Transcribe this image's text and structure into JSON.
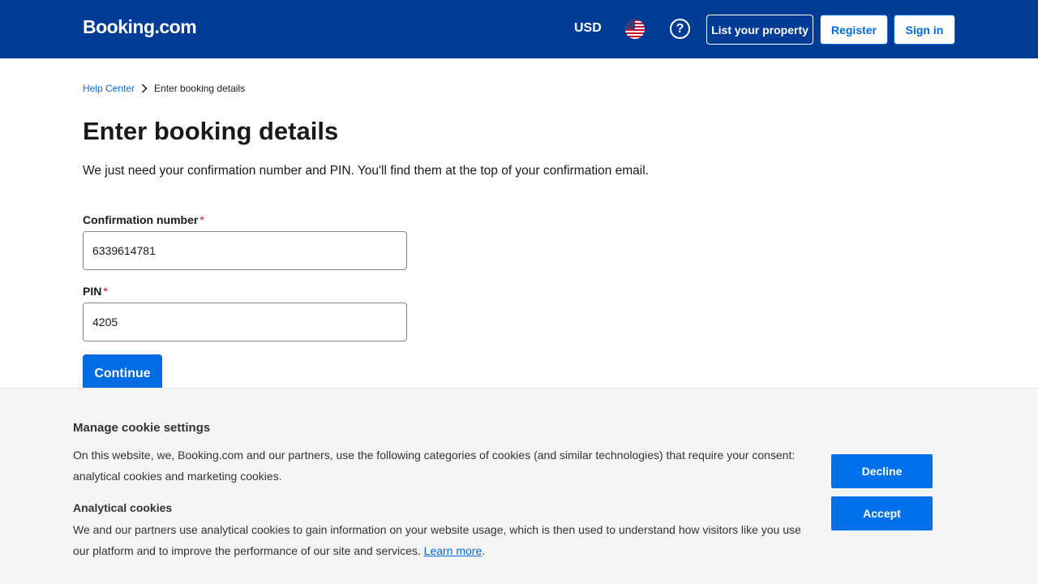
{
  "header": {
    "logo": "Booking.com",
    "currency": "USD",
    "help_glyph": "?",
    "list_property": "List your property",
    "register": "Register",
    "sign_in": "Sign in"
  },
  "breadcrumb": {
    "home": "Help Center",
    "current": "Enter booking details"
  },
  "page": {
    "title": "Enter booking details",
    "intro": "We just need your confirmation number and PIN. You'll find them at the top of your confirmation email."
  },
  "form": {
    "confirmation_label": "Confirmation number",
    "confirmation_value": "6339614781",
    "pin_label": "PIN",
    "pin_value": "4205",
    "required_mark": "*",
    "continue": "Continue"
  },
  "cookie": {
    "title": "Manage cookie settings",
    "text": "On this website, we, Booking.com and our partners, use the following categories of cookies (and similar technologies) that require your consent: analytical cookies and marketing cookies.",
    "analytical_title": "Analytical cookies",
    "analytical_text": "We and our partners use analytical cookies to gain information on your website usage, which is then used to understand how visitors like you use our platform and to improve the performance of our site and services.",
    "learn_more": "Learn more",
    "period": ".",
    "decline": "Decline",
    "accept": "Accept"
  },
  "colors": {
    "brand_header": "#003b95",
    "primary_blue": "#006ce4",
    "cookie_button": "#0071eb",
    "required_red": "#d4111e"
  },
  "icons": [
    "us-flag-icon",
    "help-icon",
    "chevron-right-icon"
  ]
}
